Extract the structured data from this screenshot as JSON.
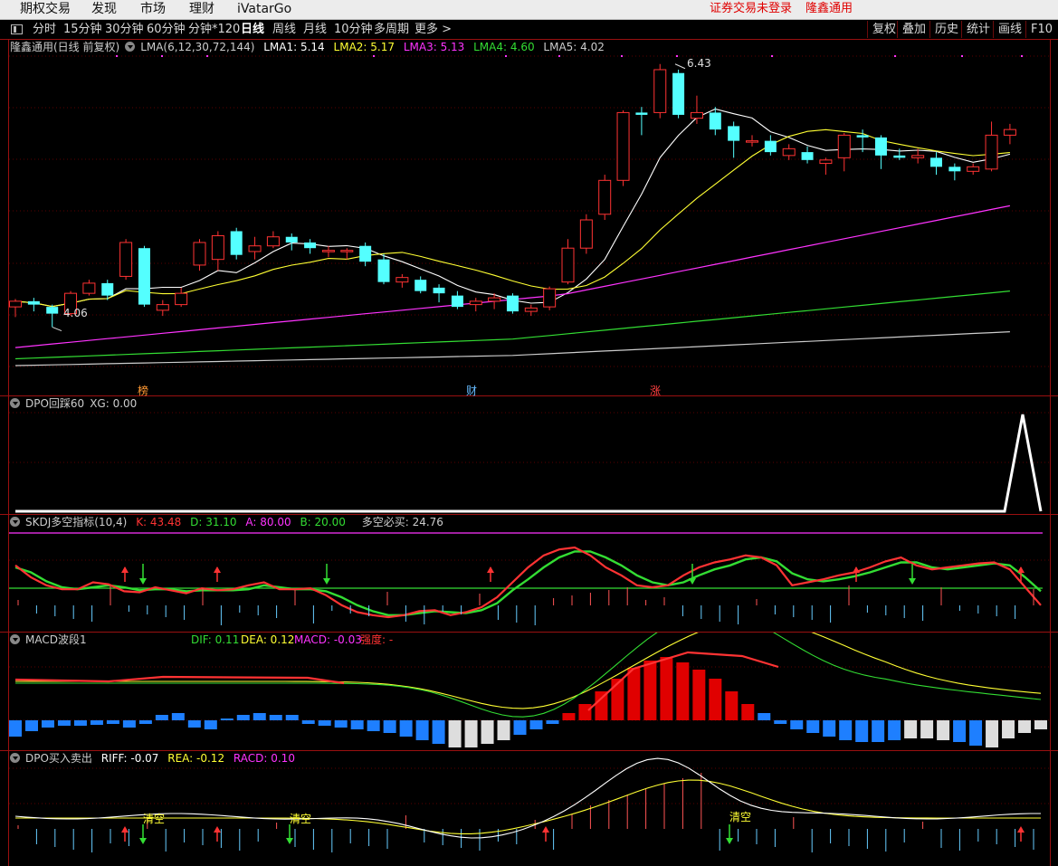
{
  "menubar": {
    "items": [
      "期权交易",
      "发现",
      "市场",
      "理财",
      "iVatarGo"
    ],
    "notice": "证券交易未登录",
    "stock": "隆鑫通用"
  },
  "toolbar": {
    "periods": [
      "分时",
      "15分钟",
      "30分钟",
      "60分钟",
      "分钟*120",
      "日线",
      "周线",
      "月线",
      "10分钟",
      "多周期",
      "更多 >"
    ],
    "active": "日线",
    "right_buttons": [
      "复权",
      "叠加",
      "历史",
      "统计",
      "画线",
      "F10"
    ]
  },
  "main_pane": {
    "title": "隆鑫通用(日线 前复权)",
    "indicator": "LMA(6,12,30,72,144)",
    "values": [
      {
        "label": "LMA1: 5.14",
        "color": "#ffffff"
      },
      {
        "label": "LMA2: 5.17",
        "color": "#ffff33"
      },
      {
        "label": "LMA3: 5.13",
        "color": "#ff33ff"
      },
      {
        "label": "LMA4: 4.60",
        "color": "#33dd33"
      },
      {
        "label": "LMA5: 4.02",
        "color": "#cccccc"
      }
    ],
    "high_label": "6.43",
    "low_label": "4.06",
    "tags": [
      {
        "text": "榜",
        "color": "#ff9933"
      },
      {
        "text": "财",
        "color": "#66bbff"
      },
      {
        "text": "涨",
        "color": "#ff4040"
      }
    ]
  },
  "dpo_pane": {
    "title": "DPO回踩60",
    "values": [
      {
        "label": "XG: 0.00",
        "color": "#cccccc"
      }
    ]
  },
  "skdj_pane": {
    "title": "SKDJ多空指标(10,4)",
    "values": [
      {
        "label": "K: 43.48",
        "color": "#ff3333"
      },
      {
        "label": "D: 31.10",
        "color": "#33dd33"
      },
      {
        "label": "A: 80.00",
        "color": "#ff33ff"
      },
      {
        "label": "B: 20.00",
        "color": "#33dd33"
      },
      {
        "label": "多空必买: 24.76",
        "color": "#cccccc"
      }
    ]
  },
  "macd_pane": {
    "title": "MACD波段1",
    "values": [
      {
        "label": "DIF: 0.11",
        "color": "#33dd33"
      },
      {
        "label": "DEA: 0.12",
        "color": "#ffff33"
      },
      {
        "label": "MACD: -0.03",
        "color": "#ff33ff"
      },
      {
        "label": "强度: -",
        "color": "#ff3333"
      }
    ]
  },
  "dpo2_pane": {
    "title": "DPO买入卖出",
    "values": [
      {
        "label": "RIFF: -0.07",
        "color": "#ffffff"
      },
      {
        "label": "REA: -0.12",
        "color": "#ffff33"
      },
      {
        "label": "RACD: 0.10",
        "color": "#ff33ff"
      }
    ],
    "signals": [
      "清空",
      "清空",
      "清空"
    ]
  },
  "colors": {
    "up": "#ff3333",
    "down": "#54ffff",
    "border": "#9a1010"
  },
  "chart_data": {
    "type": "candlestick",
    "price_range": [
      3.6,
      6.5
    ],
    "candles": [
      [
        4.28,
        4.33,
        4.19,
        4.35
      ],
      [
        4.33,
        4.3,
        4.24,
        4.36
      ],
      [
        4.28,
        4.22,
        4.1,
        4.3
      ],
      [
        4.22,
        4.4,
        4.2,
        4.42
      ],
      [
        4.4,
        4.49,
        4.38,
        4.52
      ],
      [
        4.49,
        4.38,
        4.34,
        4.52
      ],
      [
        4.55,
        4.85,
        4.52,
        4.88
      ],
      [
        4.8,
        4.3,
        4.28,
        4.82
      ],
      [
        4.25,
        4.3,
        4.2,
        4.34
      ],
      [
        4.3,
        4.4,
        4.28,
        4.45
      ],
      [
        4.65,
        4.85,
        4.6,
        4.88
      ],
      [
        4.7,
        4.91,
        4.6,
        4.95
      ],
      [
        4.95,
        4.74,
        4.7,
        4.98
      ],
      [
        4.77,
        4.82,
        4.7,
        4.9
      ],
      [
        4.82,
        4.9,
        4.8,
        4.95
      ],
      [
        4.9,
        4.85,
        4.78,
        4.93
      ],
      [
        4.85,
        4.8,
        4.75,
        4.88
      ],
      [
        4.78,
        4.78,
        4.72,
        4.82
      ],
      [
        4.78,
        4.78,
        4.7,
        4.8
      ],
      [
        4.82,
        4.68,
        4.64,
        4.85
      ],
      [
        4.7,
        4.5,
        4.48,
        4.75
      ],
      [
        4.5,
        4.54,
        4.45,
        4.57
      ],
      [
        4.52,
        4.42,
        4.4,
        4.55
      ],
      [
        4.45,
        4.4,
        4.32,
        4.48
      ],
      [
        4.38,
        4.28,
        4.26,
        4.42
      ],
      [
        4.3,
        4.33,
        4.24,
        4.36
      ],
      [
        4.33,
        4.36,
        4.26,
        4.4
      ],
      [
        4.38,
        4.24,
        4.22,
        4.4
      ],
      [
        4.24,
        4.27,
        4.2,
        4.3
      ],
      [
        4.28,
        4.44,
        4.25,
        4.46
      ],
      [
        4.5,
        4.8,
        4.48,
        4.88
      ],
      [
        4.8,
        5.05,
        4.75,
        5.1
      ],
      [
        5.1,
        5.4,
        5.05,
        5.45
      ],
      [
        5.4,
        6.0,
        5.35,
        6.02
      ],
      [
        6.0,
        5.98,
        5.8,
        6.05
      ],
      [
        6.0,
        6.38,
        5.95,
        6.43
      ],
      [
        6.35,
        5.98,
        5.95,
        6.38
      ],
      [
        5.95,
        6.0,
        5.9,
        6.15
      ],
      [
        6.0,
        5.85,
        5.8,
        6.05
      ],
      [
        5.88,
        5.75,
        5.6,
        5.92
      ],
      [
        5.75,
        5.75,
        5.7,
        5.8
      ],
      [
        5.75,
        5.65,
        5.62,
        5.8
      ],
      [
        5.62,
        5.68,
        5.58,
        5.72
      ],
      [
        5.65,
        5.58,
        5.55,
        5.7
      ],
      [
        5.55,
        5.58,
        5.45,
        5.6
      ],
      [
        5.6,
        5.8,
        5.48,
        5.82
      ],
      [
        5.8,
        5.78,
        5.65,
        5.85
      ],
      [
        5.78,
        5.62,
        5.5,
        5.8
      ],
      [
        5.62,
        5.6,
        5.58,
        5.68
      ],
      [
        5.6,
        5.62,
        5.55,
        5.68
      ],
      [
        5.6,
        5.52,
        5.45,
        5.65
      ],
      [
        5.52,
        5.48,
        5.4,
        5.55
      ],
      [
        5.48,
        5.52,
        5.45,
        5.55
      ],
      [
        5.5,
        5.8,
        5.48,
        5.92
      ],
      [
        5.8,
        5.85,
        5.72,
        5.9
      ]
    ]
  }
}
